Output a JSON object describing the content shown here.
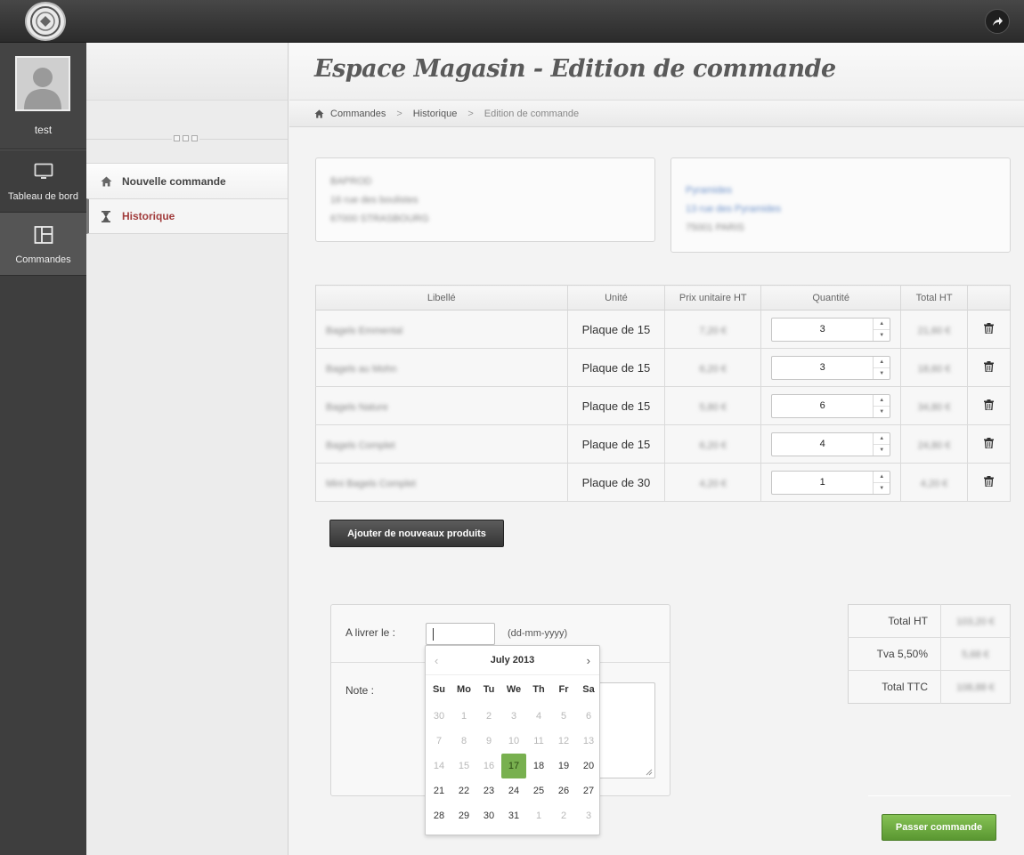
{
  "topbar": {
    "logo_icon": "brand-seal-icon",
    "share_icon": "share-arrow-icon"
  },
  "sidebar": {
    "user_name": "test",
    "items": [
      {
        "label": "Tableau de bord",
        "icon": "monitor-icon"
      },
      {
        "label": "Commandes",
        "icon": "layout-icon"
      }
    ]
  },
  "submenu": {
    "items": [
      {
        "label": "Nouvelle commande",
        "icon": "home-icon"
      },
      {
        "label": "Historique",
        "icon": "hourglass-icon"
      }
    ]
  },
  "page": {
    "title": "Espace Magasin - Edition de commande"
  },
  "breadcrumb": {
    "home": "Commandes",
    "level2": "Historique",
    "current": "Edition de commande"
  },
  "addresses": {
    "left": [
      "BAPROD",
      "16 rue des boulistes",
      "67000 STRASBOURG"
    ],
    "right": [
      "Pyramides",
      "13 rue des Pyramides",
      "75001 PARIS"
    ]
  },
  "table": {
    "headers": [
      "Libellé",
      "Unité",
      "Prix unitaire HT",
      "Quantité",
      "Total HT"
    ],
    "rows": [
      {
        "label": "Bagels Emmental",
        "unit": "Plaque de 15",
        "price": "7,20 €",
        "qty": "3",
        "total": "21,60 €"
      },
      {
        "label": "Bagels au Mohn",
        "unit": "Plaque de 15",
        "price": "6,20 €",
        "qty": "3",
        "total": "18,60 €"
      },
      {
        "label": "Bagels Nature",
        "unit": "Plaque de 15",
        "price": "5,80 €",
        "qty": "6",
        "total": "34,80 €"
      },
      {
        "label": "Bagels Complet",
        "unit": "Plaque de 15",
        "price": "6,20 €",
        "qty": "4",
        "total": "24,80 €"
      },
      {
        "label": "Mini Bagels Complet",
        "unit": "Plaque de 30",
        "price": "4,20 €",
        "qty": "1",
        "total": "4,20 €"
      }
    ]
  },
  "actions": {
    "add_products": "Ajouter de nouveaux produits",
    "submit": "Passer commande"
  },
  "delivery": {
    "date_label": "A livrer le :",
    "date_value": "",
    "date_hint": "(dd-mm-yyyy)",
    "note_label": "Note :"
  },
  "datepicker": {
    "title": "July 2013",
    "prev": "‹",
    "next": "›",
    "weekdays": [
      "Su",
      "Mo",
      "Tu",
      "We",
      "Th",
      "Fr",
      "Sa"
    ],
    "days": [
      "30",
      "1",
      "2",
      "3",
      "4",
      "5",
      "6",
      "7",
      "8",
      "9",
      "10",
      "11",
      "12",
      "13",
      "14",
      "15",
      "16",
      "17",
      "18",
      "19",
      "20",
      "21",
      "22",
      "23",
      "24",
      "25",
      "26",
      "27",
      "28",
      "29",
      "30",
      "31",
      "1",
      "2",
      "3"
    ],
    "selected": "17",
    "accent_color": "#78b04f"
  },
  "totals": [
    {
      "label": "Total HT",
      "value": "103,20 €"
    },
    {
      "label": "Tva 5,50%",
      "value": "5,68 €"
    },
    {
      "label": "Total TTC",
      "value": "108,88 €"
    }
  ]
}
